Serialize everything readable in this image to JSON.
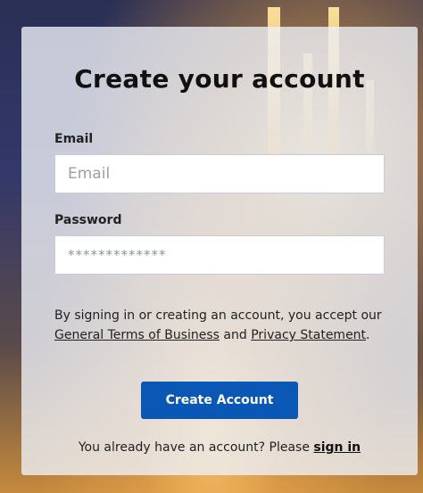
{
  "form": {
    "title": "Create your account",
    "email_label": "Email",
    "email_placeholder": "Email",
    "password_label": "Password",
    "password_placeholder": "*************",
    "consent_prefix": "By signing in or creating an account, you accept our ",
    "terms_link": "General Terms of Business",
    "consent_and": " and ",
    "privacy_link": "Privacy Statement",
    "consent_suffix": ".",
    "submit_label": "Create Account",
    "signin_prompt": "You already have an account? Please ",
    "signin_link": "sign in"
  },
  "colors": {
    "button": "#0b57b5",
    "card": "rgba(238,240,246,0.80)"
  }
}
